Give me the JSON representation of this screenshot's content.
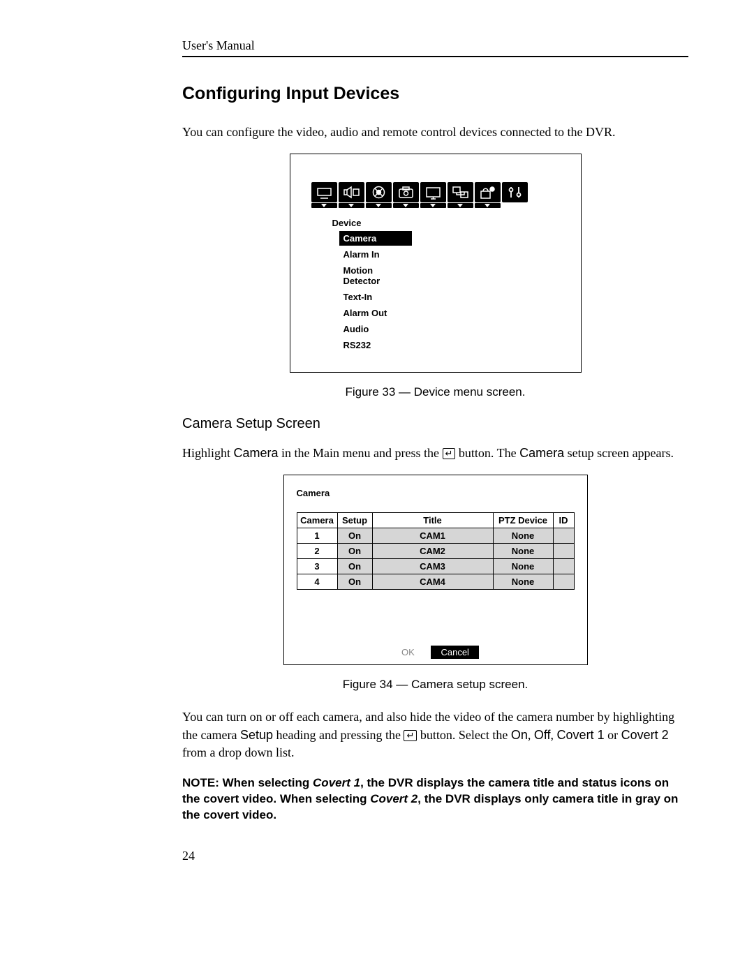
{
  "header": {
    "running": "User's Manual"
  },
  "section": {
    "title": "Configuring Input Devices"
  },
  "intro": "You can configure the video, audio and remote control devices connected to the DVR.",
  "fig33": {
    "caption": "Figure 33 — Device menu screen.",
    "menu_label": "Device",
    "items": [
      "Camera",
      "Alarm In",
      "Motion Detector",
      "Text-In",
      "Alarm Out",
      "Audio",
      "RS232"
    ],
    "selected": "Camera"
  },
  "sub": {
    "title": "Camera Setup Screen"
  },
  "para2": {
    "a": "Highlight ",
    "b": "Camera",
    "c": " in the Main menu and press the ",
    "d": " button.  The ",
    "e": "Camera",
    "f": " setup screen appears."
  },
  "fig34": {
    "caption": "Figure 34 — Camera setup screen.",
    "panel_title": "Camera",
    "headers": [
      "Camera",
      "Setup",
      "Title",
      "PTZ Device",
      "ID"
    ],
    "rows": [
      {
        "camera": "1",
        "setup": "On",
        "title": "CAM1",
        "ptz": "None",
        "id": ""
      },
      {
        "camera": "2",
        "setup": "On",
        "title": "CAM2",
        "ptz": "None",
        "id": ""
      },
      {
        "camera": "3",
        "setup": "On",
        "title": "CAM3",
        "ptz": "None",
        "id": ""
      },
      {
        "camera": "4",
        "setup": "On",
        "title": "CAM4",
        "ptz": "None",
        "id": ""
      }
    ],
    "ok": "OK",
    "cancel": "Cancel"
  },
  "para3": {
    "a": "You can turn on or off each camera, and also hide the video of the camera number by highlighting the camera ",
    "b": "Setup",
    "c": " heading and pressing the ",
    "d": " button.  Select the ",
    "e": "On",
    "f": ", ",
    "g": "Off",
    "h": ", ",
    "i": "Covert 1",
    "j": " or ",
    "k": "Covert 2",
    "l": " from a drop down list."
  },
  "note": {
    "a": "NOTE:  When selecting ",
    "b": "Covert 1",
    "c": ", the DVR displays the camera title and status icons on the covert video.  When selecting ",
    "d": "Covert 2",
    "e": ", the DVR displays only camera title in gray on the covert video."
  },
  "page_number": "24",
  "enter_glyph": "↵"
}
